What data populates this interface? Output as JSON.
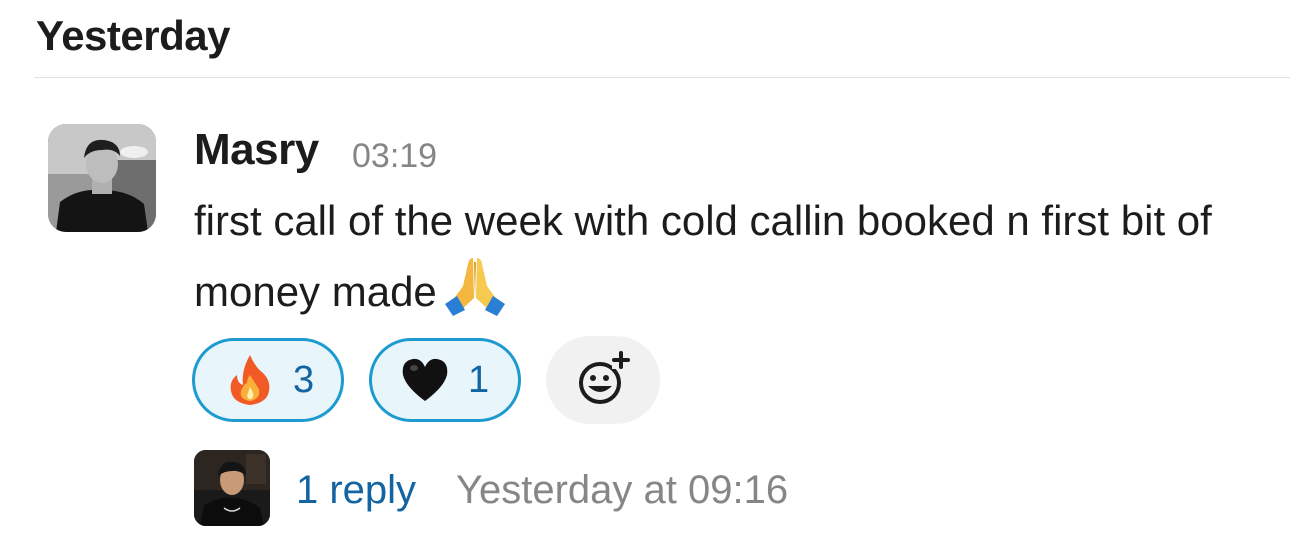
{
  "day_header": "Yesterday",
  "message": {
    "author": "Masry",
    "time": "03:19",
    "text": "first call of the week with cold callin booked n first bit of money made",
    "trailing_emoji": "folded-hands"
  },
  "reactions": [
    {
      "emoji": "fire",
      "count": "3",
      "selected": true
    },
    {
      "emoji": "black-heart",
      "count": "1",
      "selected": true
    }
  ],
  "add_reaction_icon": "add-emoji-icon",
  "thread": {
    "reply_count": "1 reply",
    "last_reply": "Yesterday at 09:16"
  },
  "colors": {
    "link": "#1264a3",
    "reaction_border": "#1d9bd1",
    "reaction_bg": "#e8f5fa",
    "muted": "#868686"
  }
}
